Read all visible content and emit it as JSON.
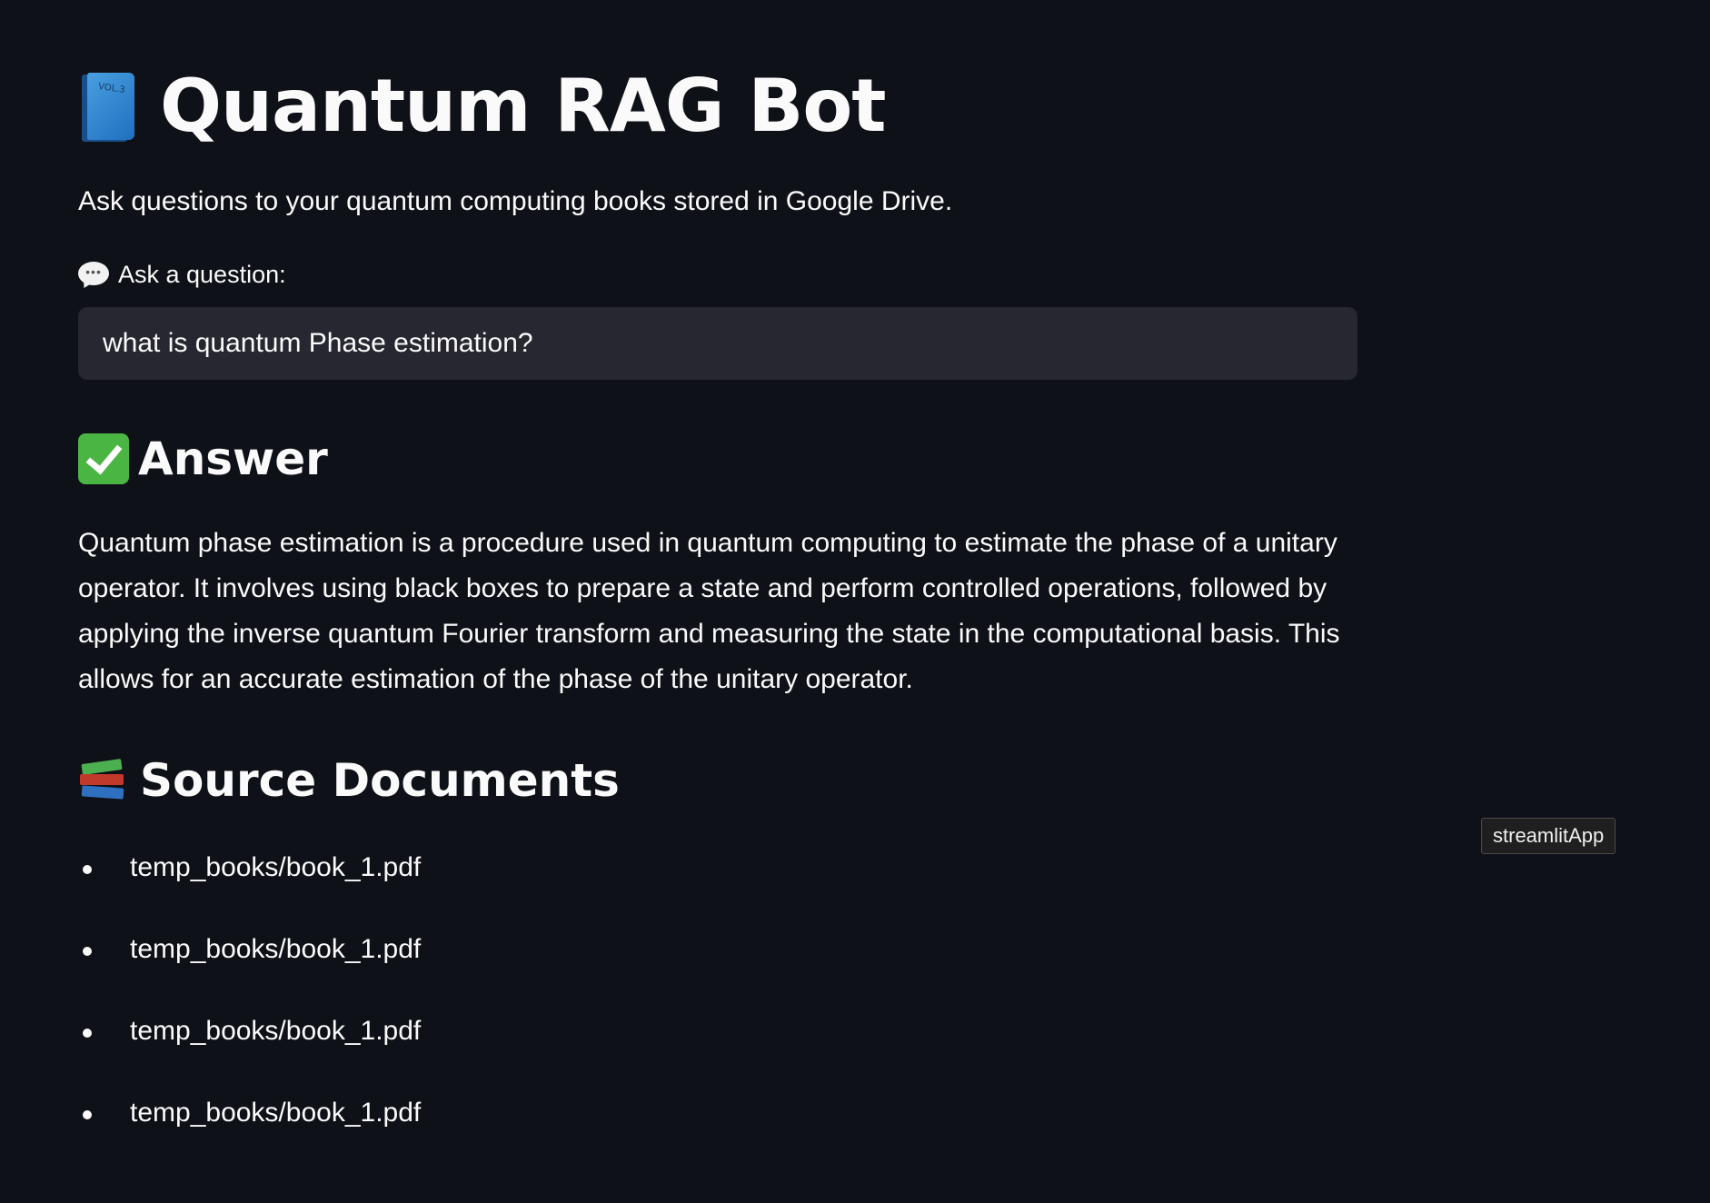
{
  "header": {
    "title": "Quantum RAG Bot",
    "book_icon_text": "VOL.3",
    "subtitle": "Ask questions to your quantum computing books stored in Google Drive."
  },
  "question": {
    "label": "Ask a question:",
    "label_icon": "speech-bubble-icon",
    "value": "what is quantum Phase estimation?"
  },
  "answer": {
    "heading": "Answer",
    "heading_icon": "check-mark-icon",
    "text": "Quantum phase estimation is a procedure used in quantum computing to estimate the phase of a unitary operator. It involves using black boxes to prepare a state and perform controlled operations, followed by applying the inverse quantum Fourier transform and measuring the state in the computational basis. This allows for an accurate estimation of the phase of the unitary operator."
  },
  "sources": {
    "heading": "Source Documents",
    "heading_icon": "books-icon",
    "items": [
      "temp_books/book_1.pdf",
      "temp_books/book_1.pdf",
      "temp_books/book_1.pdf",
      "temp_books/book_1.pdf"
    ]
  },
  "tooltip": {
    "text": "streamlitApp"
  },
  "colors": {
    "background": "#0e1117",
    "text": "#fafafa",
    "input_background": "#262730",
    "check_green": "#4bb543"
  }
}
